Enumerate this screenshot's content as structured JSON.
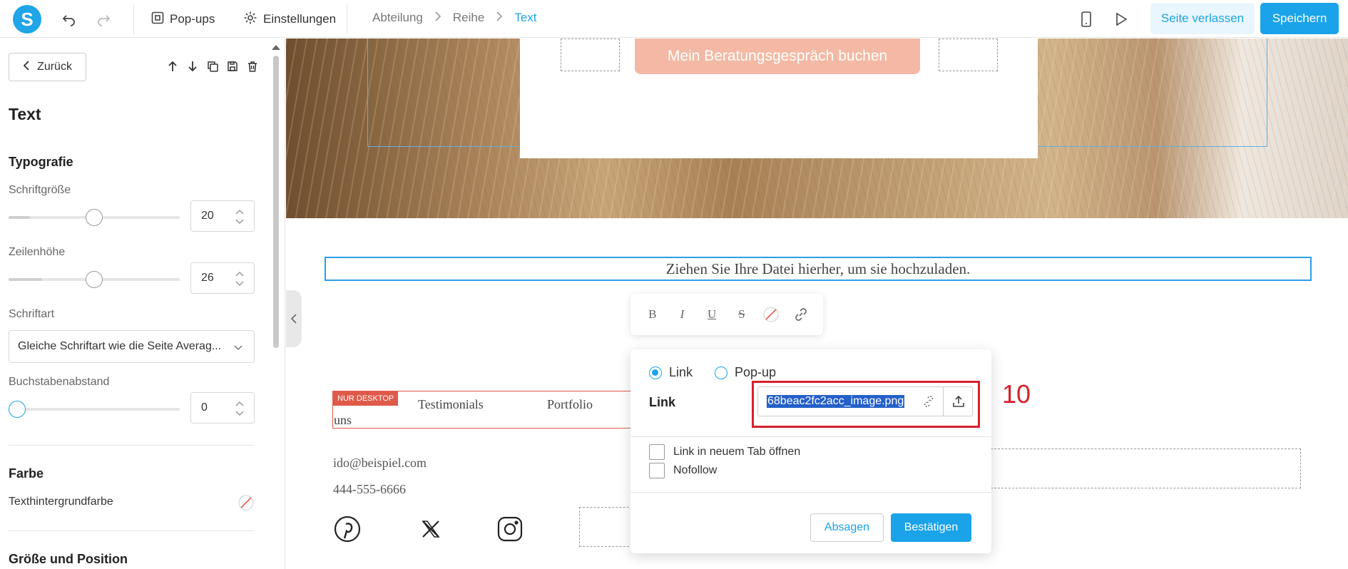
{
  "topbar": {
    "popups_label": "Pop-ups",
    "settings_label": "Einstellungen",
    "breadcrumb": [
      "Abteilung",
      "Reihe",
      "Text"
    ],
    "leave_label": "Seite verlassen",
    "save_label": "Speichern"
  },
  "sidebar": {
    "back_label": "Zurück",
    "title": "Text",
    "typography_heading": "Typografie",
    "font_size": {
      "label": "Schriftgröße",
      "value": "20",
      "level": 0.42
    },
    "line_height": {
      "label": "Zeilenhöhe",
      "value": "26",
      "level": 0.42
    },
    "font_family": {
      "label": "Schriftart",
      "value": "Gleiche Schriftart wie die Seite Averag..."
    },
    "letter_spacing": {
      "label": "Buchstabenabstand",
      "value": "0",
      "level": 0.0
    },
    "color_heading": "Farbe",
    "bg_color_label": "Texthintergrundfarbe",
    "size_heading": "Größe und Position"
  },
  "canvas": {
    "book_button": "Mein Beratungsgespräch buchen",
    "upload_text": "Ziehen Sie Ihre Datei hierher, um sie hochzuladen.",
    "nav_badge": "NUR DESKTOP",
    "nav_items": [
      "Testimonials",
      "Portfolio",
      "uns"
    ],
    "email": "ido@beispiel.com",
    "phone": "444-555-6666"
  },
  "link_dialog": {
    "radio_link": "Link",
    "radio_popup": "Pop-up",
    "link_label": "Link",
    "link_value": "68beac2fc2acc_image.png",
    "new_tab_label": "Link in neuem Tab öffnen",
    "nofollow_label": "Nofollow",
    "cancel_label": "Absagen",
    "confirm_label": "Bestätigen",
    "step_number": "10"
  },
  "colors": {
    "accent": "#1aa3e9",
    "annotation_red": "#d8202c",
    "book_button": "#f3b9a5",
    "desktop_badge": "#e05a4a"
  }
}
